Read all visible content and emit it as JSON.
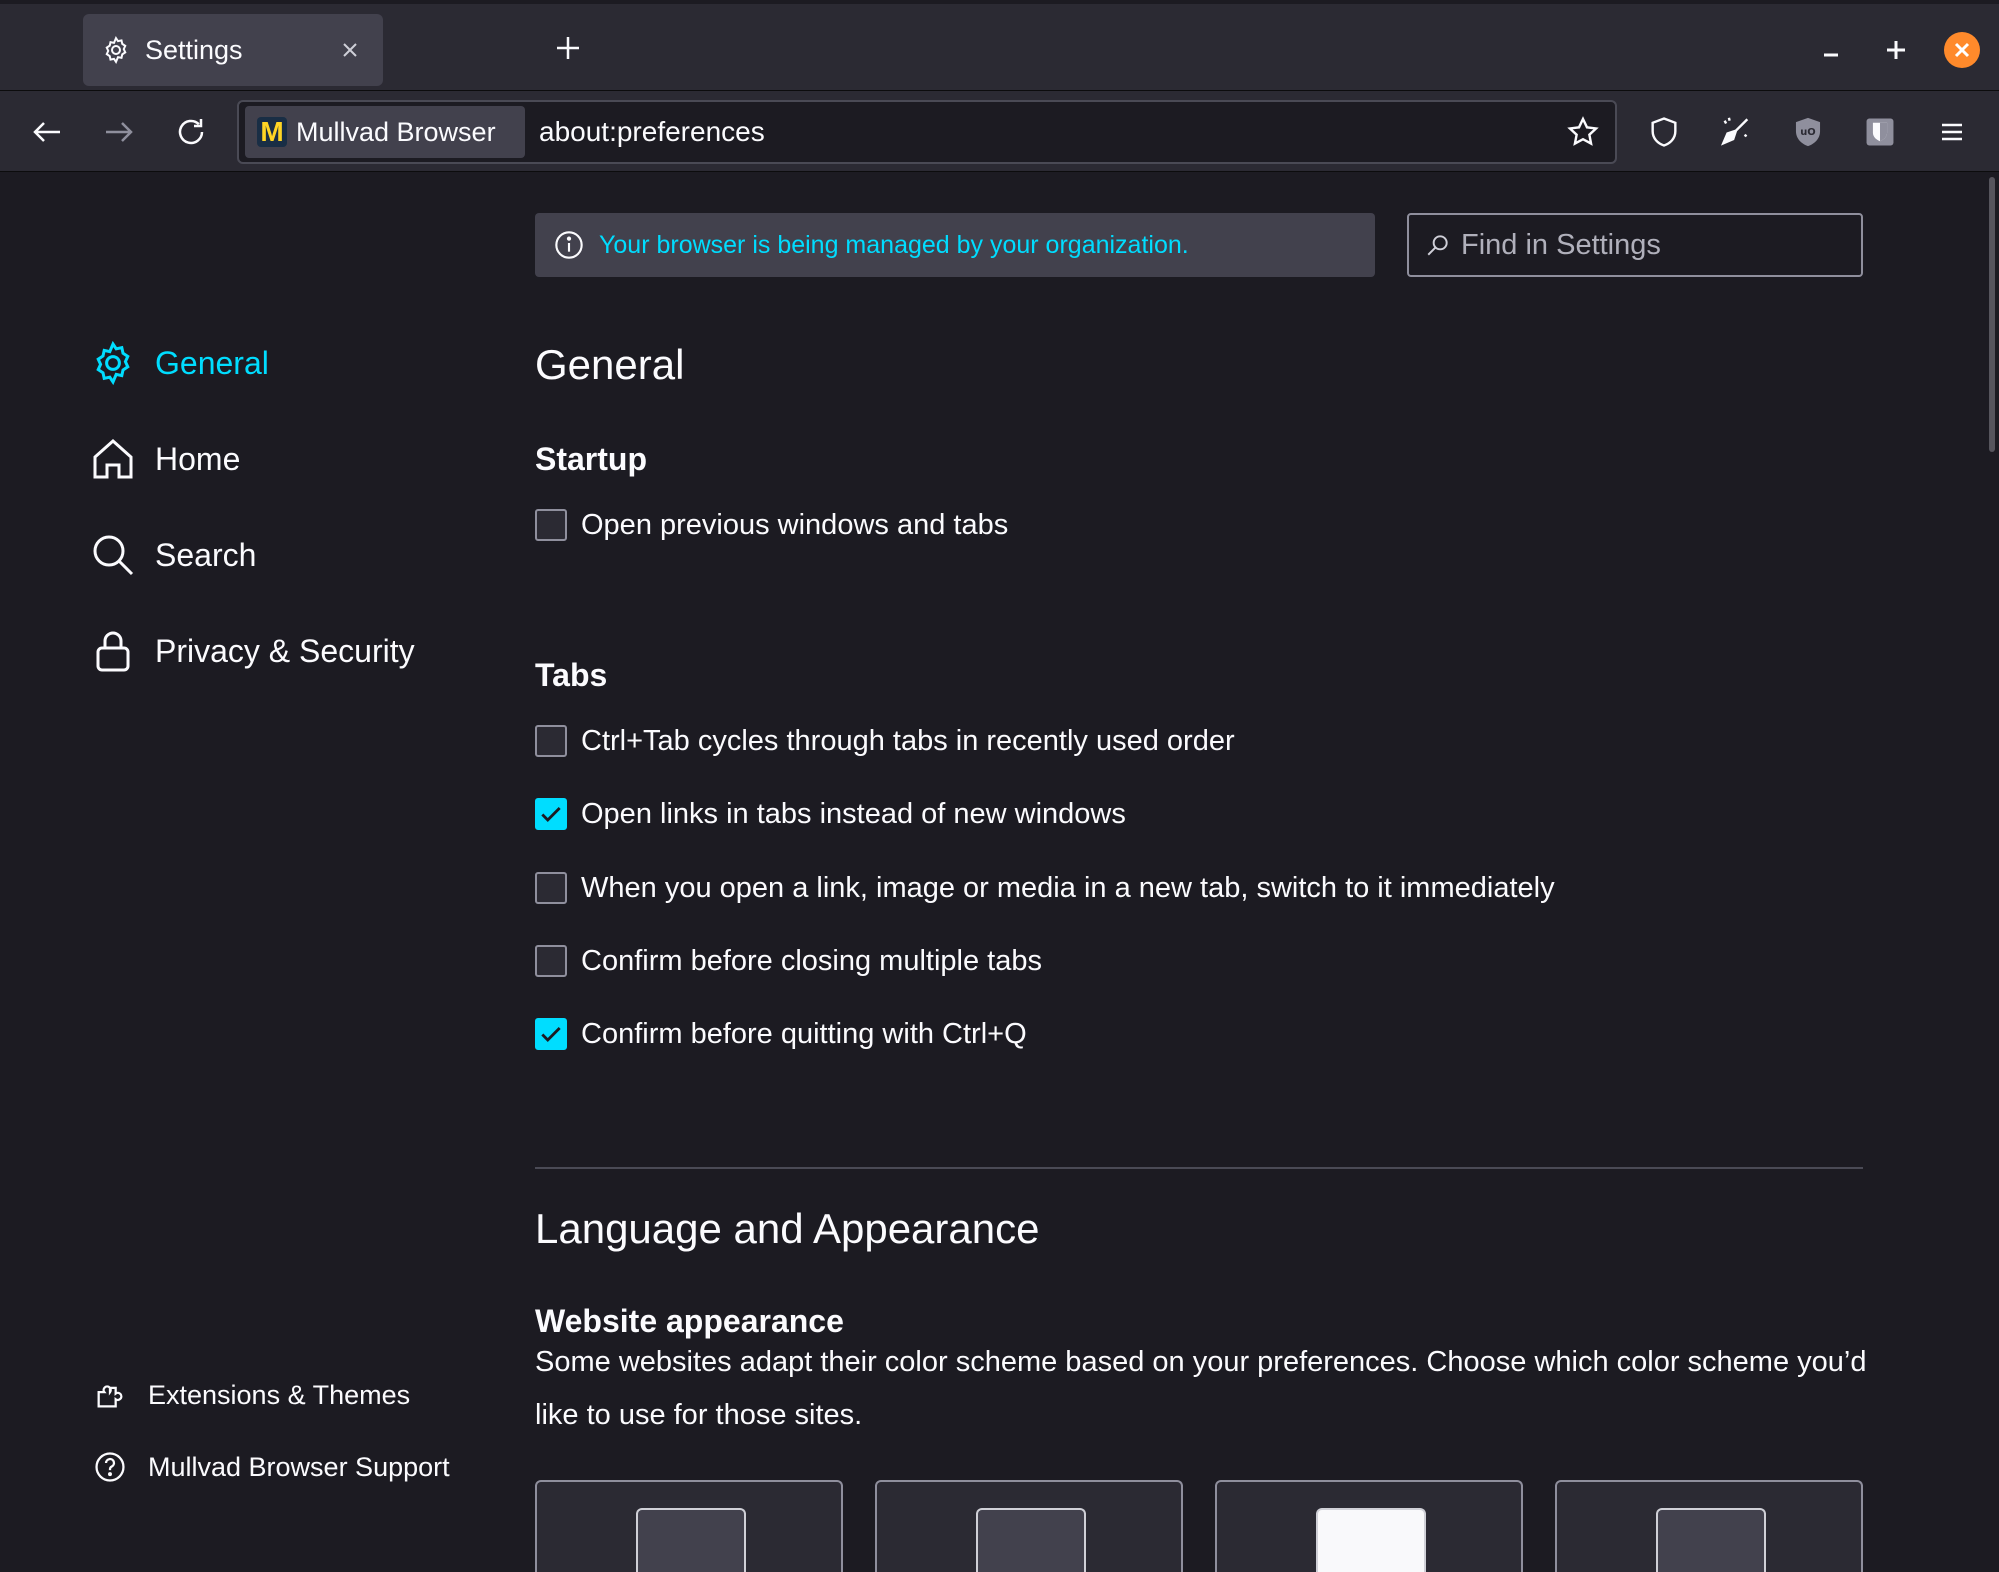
{
  "browser": {
    "tab_title": "Settings",
    "identity_label": "Mullvad Browser",
    "logo_letter": "M",
    "url": "about:preferences"
  },
  "colors": {
    "accent": "#00ddff",
    "background": "#1c1b22",
    "toolbar": "#2b2a33",
    "close_window": "#ff8a2b"
  },
  "banner": {
    "text": "Your browser is being managed by your organization."
  },
  "search": {
    "placeholder": "Find in Settings"
  },
  "sidebar": {
    "categories": [
      {
        "label": "General",
        "icon": "gear-icon",
        "selected": true
      },
      {
        "label": "Home",
        "icon": "home-icon",
        "selected": false
      },
      {
        "label": "Search",
        "icon": "magnifier-icon",
        "selected": false
      },
      {
        "label": "Privacy & Security",
        "icon": "lock-icon",
        "selected": false
      }
    ],
    "footer": [
      {
        "label": "Extensions & Themes",
        "icon": "puzzle-icon"
      },
      {
        "label": "Mullvad Browser Support",
        "icon": "help-icon"
      }
    ]
  },
  "main": {
    "title": "General",
    "startup": {
      "heading": "Startup",
      "options": [
        {
          "label": "Open previous windows and tabs",
          "checked": false
        }
      ]
    },
    "tabs": {
      "heading": "Tabs",
      "options": [
        {
          "label": "Ctrl+Tab cycles through tabs in recently used order",
          "checked": false
        },
        {
          "label": "Open links in tabs instead of new windows",
          "checked": true
        },
        {
          "label": "When you open a link, image or media in a new tab, switch to it immediately",
          "checked": false
        },
        {
          "label": "Confirm before closing multiple tabs",
          "checked": false
        },
        {
          "label": "Confirm before quitting with Ctrl+Q",
          "checked": true
        }
      ]
    },
    "language": {
      "title": "Language and Appearance",
      "website_appearance": {
        "heading": "Website appearance",
        "description": "Some websites adapt their color scheme based on your preferences. Choose which color scheme you’d like to use for those sites."
      }
    }
  }
}
